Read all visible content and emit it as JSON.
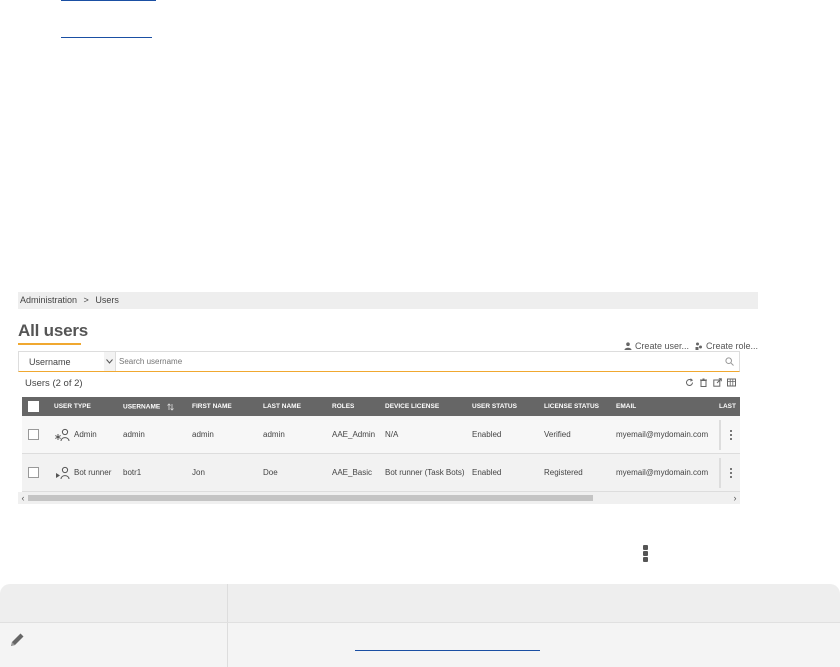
{
  "breadcrumb": {
    "root": "Administration",
    "sep": ">",
    "current": "Users"
  },
  "page": {
    "title": "All users"
  },
  "actions": {
    "create_user": "Create user...",
    "create_role": "Create role..."
  },
  "search": {
    "field": "Username",
    "placeholder": "Search username"
  },
  "table": {
    "count_label": "Users (2 of 2)",
    "headers": [
      "USER TYPE",
      "USERNAME",
      "FIRST NAME",
      "LAST NAME",
      "ROLES",
      "DEVICE LICENSE",
      "USER STATUS",
      "LICENSE STATUS",
      "EMAIL",
      "LAST"
    ],
    "rows": [
      {
        "user_type": "Admin",
        "username": "admin",
        "first_name": "admin",
        "last_name": "admin",
        "roles": "AAE_Admin",
        "device_license": "N/A",
        "user_status": "Enabled",
        "license_status": "Verified",
        "email": "myemail@mydomain.com"
      },
      {
        "user_type": "Bot runner",
        "username": "botr1",
        "first_name": "Jon",
        "last_name": "Doe",
        "roles": "AAE_Basic",
        "device_license": "Bot runner (Task Bots)",
        "user_status": "Enabled",
        "license_status": "Registered",
        "email": "myemail@mydomain.com"
      }
    ]
  },
  "colors": {
    "accent": "#f0a830",
    "header_bg": "#666666",
    "link": "#1a4fa3"
  },
  "icons": [
    "user-icon",
    "role-icon",
    "chevron-down-icon",
    "search-icon",
    "refresh-icon",
    "trash-icon",
    "export-icon",
    "columns-icon",
    "admin-user-icon",
    "bot-runner-icon",
    "sort-icon",
    "kebab-icon",
    "pencil-icon"
  ]
}
